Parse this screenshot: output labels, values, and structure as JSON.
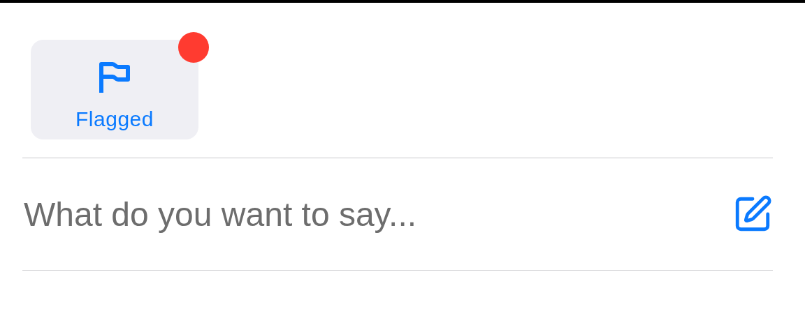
{
  "filter": {
    "label": "Flagged",
    "badge": true
  },
  "composer": {
    "placeholder": "What do you want to say..."
  }
}
